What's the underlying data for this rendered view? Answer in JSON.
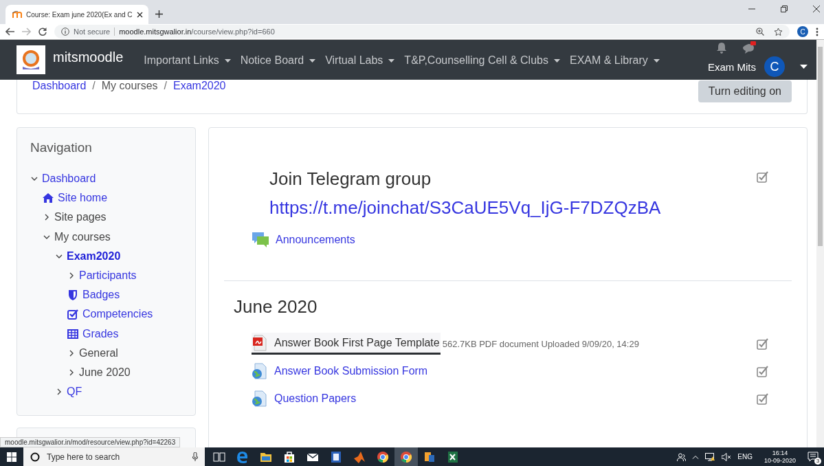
{
  "browser": {
    "tab": {
      "title": "Course: Exam june 2020(Ex and C"
    },
    "address": {
      "security": "Not secure",
      "host": "moodle.mitsgwalior.in",
      "path": "/course/view.php?id=660"
    },
    "profile": "C"
  },
  "navbar": {
    "brand": "mitsmoodle",
    "menus": [
      "Important Links",
      "Notice Board",
      "Virtual Labs",
      "T&P,Counselling Cell & Clubs",
      "EXAM & Library"
    ],
    "user": "Exam Mits",
    "avatar": "C"
  },
  "breadcrumb": {
    "separator": "/",
    "items": [
      {
        "label": "Dashboard",
        "link": true
      },
      {
        "label": "My courses",
        "link": false
      },
      {
        "label": "Exam2020",
        "link": true
      }
    ]
  },
  "edit_button": "Turn editing on",
  "navigation": {
    "title": "Navigation",
    "items": [
      {
        "label": "Dashboard",
        "link": true,
        "expanded": true,
        "selected": false,
        "children": [
          {
            "label": "Site home",
            "link": true,
            "kind": "home",
            "selected": false
          },
          {
            "label": "Site pages",
            "link": false,
            "expanded": false,
            "selected": false
          },
          {
            "label": "My courses",
            "link": false,
            "expanded": true,
            "selected": false,
            "children": [
              {
                "label": "Exam2020",
                "link": true,
                "expanded": true,
                "selected": true,
                "children": [
                  {
                    "label": "Participants",
                    "link": true,
                    "expanded": false,
                    "selected": false
                  },
                  {
                    "label": "Badges",
                    "link": true,
                    "kind": "badge",
                    "selected": false
                  },
                  {
                    "label": "Competencies",
                    "link": true,
                    "kind": "check",
                    "selected": false
                  },
                  {
                    "label": "Grades",
                    "link": true,
                    "kind": "table",
                    "selected": false
                  },
                  {
                    "label": "General",
                    "link": false,
                    "expanded": false,
                    "selected": false
                  },
                  {
                    "label": "June 2020",
                    "link": false,
                    "expanded": false,
                    "selected": false
                  }
                ]
              },
              {
                "label": "QF",
                "link": true,
                "expanded": false,
                "selected": false
              }
            ]
          }
        ]
      }
    ]
  },
  "sections": [
    {
      "items": [
        {
          "kind": "label",
          "title": "Join Telegram group",
          "link": "https://t.me/joinchat/S3CaUE5Vq_IjG-F7DZQzBA",
          "completed": true
        },
        {
          "kind": "forum",
          "name": "Announcements",
          "hovered": false
        }
      ]
    },
    {
      "title": "June 2020",
      "items": [
        {
          "kind": "pdf",
          "name": "Answer Book First Page Template",
          "details": "562.7KB PDF document Uploaded 9/09/20, 14:29",
          "hovered": true,
          "completed": true
        },
        {
          "kind": "url",
          "name": "Answer Book Submission Form",
          "hovered": false,
          "completed": true
        },
        {
          "kind": "url",
          "name": "Question Papers",
          "hovered": false,
          "completed": true
        }
      ]
    }
  ],
  "status_url": "moodle.mitsgwalior.in/mod/resource/view.php?id=42263",
  "taskbar": {
    "search_placeholder": "Type here to search",
    "apps": [
      {
        "kind": "task-view",
        "selected": false
      },
      {
        "kind": "edge",
        "selected": false
      },
      {
        "kind": "folder",
        "selected": false
      },
      {
        "kind": "store",
        "selected": false
      },
      {
        "kind": "mail",
        "selected": false
      },
      {
        "kind": "notes",
        "selected": false
      },
      {
        "kind": "matlab",
        "selected": false
      },
      {
        "kind": "chrome",
        "selected": false
      },
      {
        "kind": "chrome",
        "selected": true
      },
      {
        "kind": "app",
        "selected": false
      },
      {
        "kind": "sheet",
        "selected": false
      }
    ],
    "language": "ENG",
    "time": "16:14",
    "date": "10-09-2020",
    "notifications": "3"
  }
}
